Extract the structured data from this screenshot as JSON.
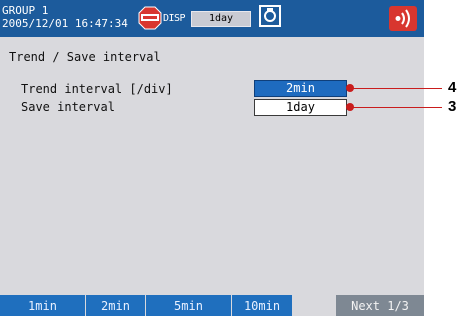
{
  "status_bar": {
    "group": "GROUP 1",
    "datetime": "2005/12/01 16:47:34",
    "stop_icon": "stop-icon",
    "disp_label": "DISP",
    "disp_value": "1day",
    "save_icon": "save-icon",
    "alarm_icon": "alarm-icon"
  },
  "screen": {
    "title": "Trend / Save interval",
    "rows": [
      {
        "label": "Trend interval [/div]",
        "value": "2min"
      },
      {
        "label": "Save interval",
        "value": "1day"
      }
    ]
  },
  "softkeys": [
    "1min",
    "2min",
    "5min",
    "10min",
    "Next 1/3"
  ],
  "callouts": [
    "4",
    "3"
  ],
  "colors": {
    "status_bar": "#1c5b9c",
    "selected_value": "#1e6bbf",
    "softkey": "#1f6fbe",
    "next_softkey": "#7e8893",
    "callout": "#c91d1d"
  }
}
